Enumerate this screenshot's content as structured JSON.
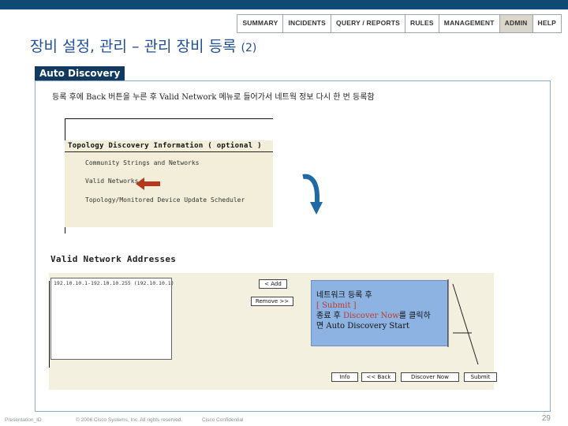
{
  "nav": {
    "items": [
      "SUMMARY",
      "INCIDENTS",
      "QUERY / REPORTS",
      "RULES",
      "MANAGEMENT",
      "ADMIN",
      "HELP"
    ],
    "active": "ADMIN"
  },
  "title": {
    "main": "장비 설정, 관리 – 관리 장비 등록",
    "sub": "(2)"
  },
  "section_label": "Auto Discovery",
  "instruction": "등록 후에 Back 버튼을 누른 후 Valid Network 메뉴로 들어가서 네트웍 정보 다시 한 번 등록함",
  "topology": {
    "header": "Topology Discovery Information ( optional )",
    "items": [
      "Community Strings and Networks",
      "Valid Networks",
      "Topology/Monitored Device Update Scheduler"
    ]
  },
  "valid_networks": {
    "title": "Valid Network Addresses",
    "list_entry": "192.10.10.1-192.10.10.255 (192.10.10.1)",
    "add_button": "< Add",
    "remove_button": "Remove >>"
  },
  "callout": {
    "line1": "네트워크 등록 후",
    "line2": "[ Submit ]",
    "line3_pre": "종료 후 ",
    "line3_red": "Discover Now",
    "line3_post": "를 클릭하",
    "line4": "면 Auto Discovery Start"
  },
  "bottom_buttons": [
    "Info",
    "<< Back",
    "Discover Now",
    "Submit"
  ],
  "footer": {
    "presentation_id": "Presentation_ID",
    "copyright": "© 2006 Cisco Systems, Inc. All rights reserved.",
    "confidential": "Cisco Confidential",
    "page": "29"
  },
  "colors": {
    "topbar": "#0f4a73",
    "title": "#1f4e9a",
    "section_label_bg": "#123a5e",
    "callout_bg": "#8db3e2",
    "arrow_red": "#b5391e",
    "arrow_blue": "#1f6aa5"
  }
}
